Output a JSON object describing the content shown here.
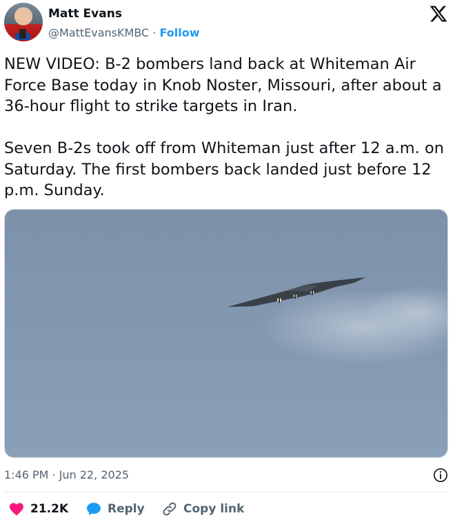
{
  "author": {
    "display_name": "Matt Evans",
    "handle": "@MattEvansKMBC",
    "separator": "·",
    "follow_label": "Follow"
  },
  "tweet": {
    "text": "NEW VIDEO: B-2 bombers land back at Whiteman Air Force Base today in Knob Noster, Missouri, after about a 36-hour flight to strike targets in Iran.\n\nSeven B-2s took off from Whiteman just after 12 a.m. on Saturday. The first bombers back landed just before 12 p.m. Sunday.",
    "timestamp": "1:46 PM · Jun 22, 2025"
  },
  "actions": {
    "like_count": "21.2K",
    "reply_label": "Reply",
    "copy_link_label": "Copy link"
  },
  "colors": {
    "accent": "#1d9bf0",
    "like": "#f91880",
    "sky": "#7e94ad"
  }
}
